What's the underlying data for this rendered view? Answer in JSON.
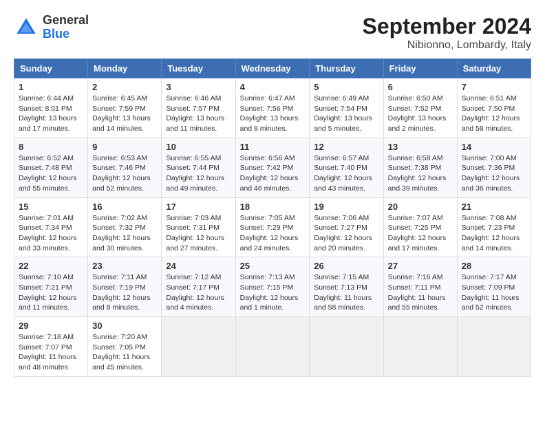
{
  "header": {
    "logo_general": "General",
    "logo_blue": "Blue",
    "month_year": "September 2024",
    "location": "Nibionno, Lombardy, Italy"
  },
  "days_of_week": [
    "Sunday",
    "Monday",
    "Tuesday",
    "Wednesday",
    "Thursday",
    "Friday",
    "Saturday"
  ],
  "weeks": [
    [
      {
        "day": 1,
        "sunrise": "6:44 AM",
        "sunset": "8:01 PM",
        "daylight": "13 hours and 17 minutes."
      },
      {
        "day": 2,
        "sunrise": "6:45 AM",
        "sunset": "7:59 PM",
        "daylight": "13 hours and 14 minutes."
      },
      {
        "day": 3,
        "sunrise": "6:46 AM",
        "sunset": "7:57 PM",
        "daylight": "13 hours and 11 minutes."
      },
      {
        "day": 4,
        "sunrise": "6:47 AM",
        "sunset": "7:56 PM",
        "daylight": "13 hours and 8 minutes."
      },
      {
        "day": 5,
        "sunrise": "6:49 AM",
        "sunset": "7:54 PM",
        "daylight": "13 hours and 5 minutes."
      },
      {
        "day": 6,
        "sunrise": "6:50 AM",
        "sunset": "7:52 PM",
        "daylight": "13 hours and 2 minutes."
      },
      {
        "day": 7,
        "sunrise": "6:51 AM",
        "sunset": "7:50 PM",
        "daylight": "12 hours and 58 minutes."
      }
    ],
    [
      {
        "day": 8,
        "sunrise": "6:52 AM",
        "sunset": "7:48 PM",
        "daylight": "12 hours and 55 minutes."
      },
      {
        "day": 9,
        "sunrise": "6:53 AM",
        "sunset": "7:46 PM",
        "daylight": "12 hours and 52 minutes."
      },
      {
        "day": 10,
        "sunrise": "6:55 AM",
        "sunset": "7:44 PM",
        "daylight": "12 hours and 49 minutes."
      },
      {
        "day": 11,
        "sunrise": "6:56 AM",
        "sunset": "7:42 PM",
        "daylight": "12 hours and 46 minutes."
      },
      {
        "day": 12,
        "sunrise": "6:57 AM",
        "sunset": "7:40 PM",
        "daylight": "12 hours and 43 minutes."
      },
      {
        "day": 13,
        "sunrise": "6:58 AM",
        "sunset": "7:38 PM",
        "daylight": "12 hours and 39 minutes."
      },
      {
        "day": 14,
        "sunrise": "7:00 AM",
        "sunset": "7:36 PM",
        "daylight": "12 hours and 36 minutes."
      }
    ],
    [
      {
        "day": 15,
        "sunrise": "7:01 AM",
        "sunset": "7:34 PM",
        "daylight": "12 hours and 33 minutes."
      },
      {
        "day": 16,
        "sunrise": "7:02 AM",
        "sunset": "7:32 PM",
        "daylight": "12 hours and 30 minutes."
      },
      {
        "day": 17,
        "sunrise": "7:03 AM",
        "sunset": "7:31 PM",
        "daylight": "12 hours and 27 minutes."
      },
      {
        "day": 18,
        "sunrise": "7:05 AM",
        "sunset": "7:29 PM",
        "daylight": "12 hours and 24 minutes."
      },
      {
        "day": 19,
        "sunrise": "7:06 AM",
        "sunset": "7:27 PM",
        "daylight": "12 hours and 20 minutes."
      },
      {
        "day": 20,
        "sunrise": "7:07 AM",
        "sunset": "7:25 PM",
        "daylight": "12 hours and 17 minutes."
      },
      {
        "day": 21,
        "sunrise": "7:08 AM",
        "sunset": "7:23 PM",
        "daylight": "12 hours and 14 minutes."
      }
    ],
    [
      {
        "day": 22,
        "sunrise": "7:10 AM",
        "sunset": "7:21 PM",
        "daylight": "12 hours and 11 minutes."
      },
      {
        "day": 23,
        "sunrise": "7:11 AM",
        "sunset": "7:19 PM",
        "daylight": "12 hours and 8 minutes."
      },
      {
        "day": 24,
        "sunrise": "7:12 AM",
        "sunset": "7:17 PM",
        "daylight": "12 hours and 4 minutes."
      },
      {
        "day": 25,
        "sunrise": "7:13 AM",
        "sunset": "7:15 PM",
        "daylight": "12 hours and 1 minute."
      },
      {
        "day": 26,
        "sunrise": "7:15 AM",
        "sunset": "7:13 PM",
        "daylight": "11 hours and 58 minutes."
      },
      {
        "day": 27,
        "sunrise": "7:16 AM",
        "sunset": "7:11 PM",
        "daylight": "11 hours and 55 minutes."
      },
      {
        "day": 28,
        "sunrise": "7:17 AM",
        "sunset": "7:09 PM",
        "daylight": "11 hours and 52 minutes."
      }
    ],
    [
      {
        "day": 29,
        "sunrise": "7:18 AM",
        "sunset": "7:07 PM",
        "daylight": "11 hours and 48 minutes."
      },
      {
        "day": 30,
        "sunrise": "7:20 AM",
        "sunset": "7:05 PM",
        "daylight": "11 hours and 45 minutes."
      },
      null,
      null,
      null,
      null,
      null
    ]
  ]
}
